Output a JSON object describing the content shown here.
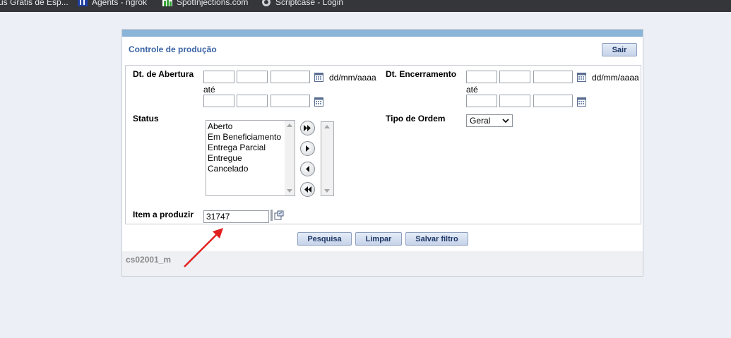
{
  "bookmarks": [
    {
      "label": "us Grátis de Esp...",
      "icon": "page-icon"
    },
    {
      "label": "Agents - ngrok",
      "icon": "ngrok-icon"
    },
    {
      "label": "SpotInjections.com",
      "icon": "spot-icon"
    },
    {
      "label": "Scriptcase - Login",
      "icon": "scriptcase-icon"
    }
  ],
  "panel": {
    "title": "Controle de produção",
    "exit_label": "Sair"
  },
  "form": {
    "abertura_label": "Dt. de Abertura",
    "encerramento_label": "Dt. Encerramento",
    "date_format": "dd/mm/aaaa",
    "ate": "até",
    "status_label": "Status",
    "status_options": [
      "Aberto",
      "Em Beneficiamento",
      "Entrega Parcial",
      "Entregue",
      "Cancelado"
    ],
    "tipo_label": "Tipo de Ordem",
    "tipo_value": "Geral",
    "item_label": "Item a produzir",
    "item_value": "31747"
  },
  "buttons": {
    "pesquisa": "Pesquisa",
    "limpar": "Limpar",
    "salvar": "Salvar filtro"
  },
  "footer": {
    "code": "cs02001_m"
  },
  "colors": {
    "accent_bar": "#8ab4d8",
    "title": "#3a63a5",
    "annotation_arrow": "#e02020"
  }
}
